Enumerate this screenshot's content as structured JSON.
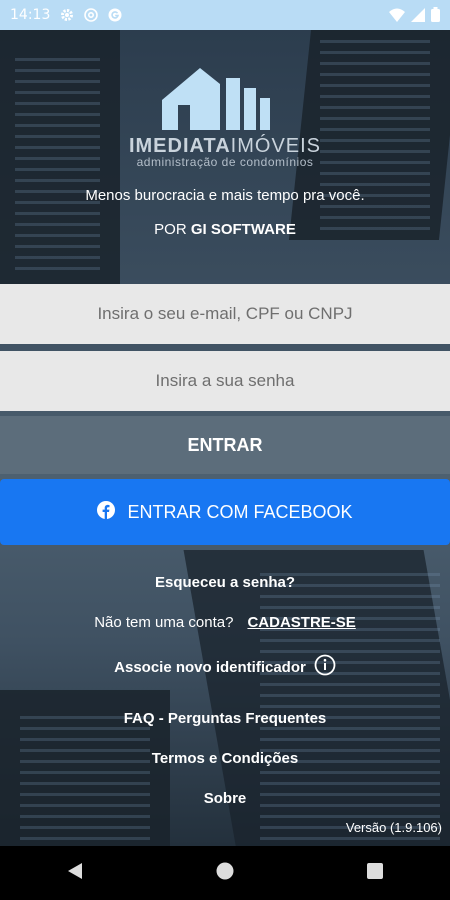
{
  "status_bar": {
    "time": "14:13"
  },
  "brand": {
    "name_bold": "IMEDIATA",
    "name_light": "IMÓVEIS",
    "subtitle": "administração de condomínios"
  },
  "tagline": "Menos burocracia e mais tempo pra você.",
  "by": {
    "prefix": "POR",
    "company": "GI SOFTWARE"
  },
  "form": {
    "email_placeholder": "Insira o seu e-mail, CPF ou CNPJ",
    "password_placeholder": "Insira a sua senha",
    "login_label": "ENTRAR",
    "facebook_label": "ENTRAR COM FACEBOOK"
  },
  "links": {
    "forgot": "Esqueceu a senha?",
    "no_account": "Não tem uma conta?",
    "signup": "CADASTRE-SE",
    "associate": "Associe novo identificador",
    "faq": "FAQ - Perguntas Frequentes",
    "terms": "Termos e Condições",
    "about": "Sobre"
  },
  "version": "Versão (1.9.106)",
  "colors": {
    "status_bar": "#b9dcf5",
    "login_button": "#5c6d7b",
    "facebook_button": "#1877f2",
    "field_bg": "#e8e8e8"
  },
  "icons": [
    "gear-icon",
    "at-icon",
    "g-icon",
    "wifi-icon",
    "signal-icon",
    "battery-icon",
    "facebook-icon",
    "info-icon",
    "back-icon",
    "home-icon",
    "recents-icon"
  ]
}
